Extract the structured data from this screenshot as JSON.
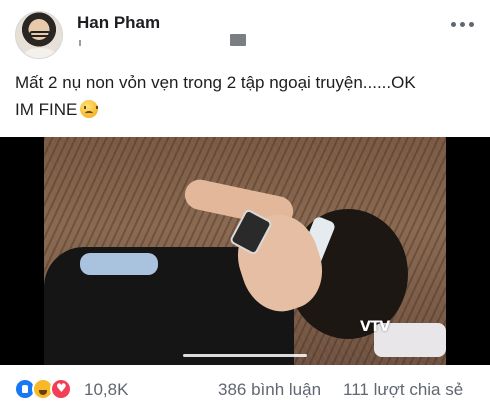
{
  "post": {
    "author": "Han Pham",
    "text_line1": "Mất 2 nụ non vỏn vẹn trong 2 tập ngoại truyện......OK",
    "text_line2": "IM FINE",
    "emoji": "persevere-face-icon"
  },
  "video": {
    "channel_logo": "VTV",
    "progress": 0.5
  },
  "footer": {
    "reactions": [
      "like-icon",
      "haha-icon",
      "love-icon"
    ],
    "reaction_count": "10,8K",
    "comments": "386 bình luận",
    "shares": "111 lượt chia sẻ"
  },
  "colors": {
    "like": "#1877f2",
    "haha": "#f7b928",
    "love": "#f33e58",
    "secondary_text": "#606770"
  }
}
